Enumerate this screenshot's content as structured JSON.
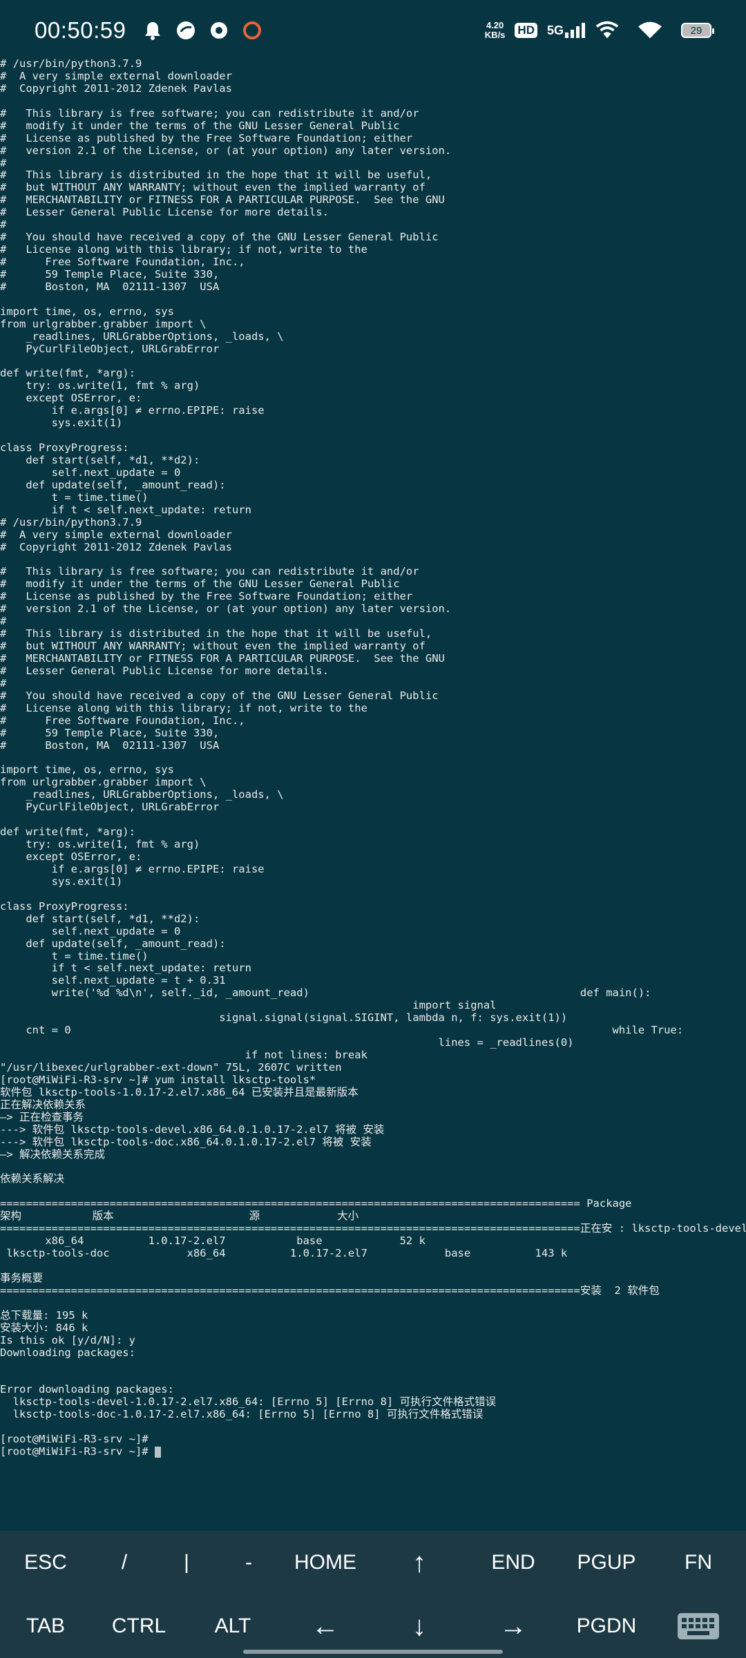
{
  "status_bar": {
    "time": "00:50:59",
    "net_speed_value": "4.20",
    "net_speed_unit": "KB/s",
    "hd_badge": "HD",
    "network": "5G",
    "battery": "29",
    "icons": [
      "bell-icon",
      "app-icon",
      "app-icon-2",
      "record-icon",
      "signal-icon",
      "wifi-calling-icon",
      "wifi-icon",
      "battery-icon"
    ]
  },
  "terminal": {
    "lines": [
      "# /usr/bin/python3.7.9",
      "#  A very simple external downloader",
      "#  Copyright 2011-2012 Zdenek Pavlas",
      "",
      "#   This library is free software; you can redistribute it and/or",
      "#   modify it under the terms of the GNU Lesser General Public",
      "#   License as published by the Free Software Foundation; either",
      "#   version 2.1 of the License, or (at your option) any later version.",
      "#",
      "#   This library is distributed in the hope that it will be useful,",
      "#   but WITHOUT ANY WARRANTY; without even the implied warranty of",
      "#   MERCHANTABILITY or FITNESS FOR A PARTICULAR PURPOSE.  See the GNU",
      "#   Lesser General Public License for more details.",
      "#",
      "#   You should have received a copy of the GNU Lesser General Public",
      "#   License along with this library; if not, write to the",
      "#      Free Software Foundation, Inc.,",
      "#      59 Temple Place, Suite 330,",
      "#      Boston, MA  02111-1307  USA",
      "",
      "import time, os, errno, sys",
      "from urlgrabber.grabber import \\",
      "    _readlines, URLGrabberOptions, _loads, \\",
      "    PyCurlFileObject, URLGrabError",
      "",
      "def write(fmt, *arg):",
      "    try: os.write(1, fmt % arg)",
      "    except OSError, e:",
      "        if e.args[0] ≠ errno.EPIPE: raise",
      "        sys.exit(1)",
      "",
      "class ProxyProgress:",
      "    def start(self, *d1, **d2):",
      "        self.next_update = 0",
      "    def update(self, _amount_read):",
      "        t = time.time()",
      "        if t < self.next_update: return",
      "# /usr/bin/python3.7.9",
      "#  A very simple external downloader",
      "#  Copyright 2011-2012 Zdenek Pavlas",
      "",
      "#   This library is free software; you can redistribute it and/or",
      "#   modify it under the terms of the GNU Lesser General Public",
      "#   License as published by the Free Software Foundation; either",
      "#   version 2.1 of the License, or (at your option) any later version.",
      "#",
      "#   This library is distributed in the hope that it will be useful,",
      "#   but WITHOUT ANY WARRANTY; without even the implied warranty of",
      "#   MERCHANTABILITY or FITNESS FOR A PARTICULAR PURPOSE.  See the GNU",
      "#   Lesser General Public License for more details.",
      "#",
      "#   You should have received a copy of the GNU Lesser General Public",
      "#   License along with this library; if not, write to the",
      "#      Free Software Foundation, Inc.,",
      "#      59 Temple Place, Suite 330,",
      "#      Boston, MA  02111-1307  USA",
      "",
      "import time, os, errno, sys",
      "from urlgrabber.grabber import \\",
      "    _readlines, URLGrabberOptions, _loads, \\",
      "    PyCurlFileObject, URLGrabError",
      "",
      "def write(fmt, *arg):",
      "    try: os.write(1, fmt % arg)",
      "    except OSError, e:",
      "        if e.args[0] ≠ errno.EPIPE: raise",
      "        sys.exit(1)",
      "",
      "class ProxyProgress:",
      "    def start(self, *d1, **d2):",
      "        self.next_update = 0",
      "    def update(self, _amount_read):",
      "        t = time.time()",
      "        if t < self.next_update: return",
      "        self.next_update = t + 0.31",
      "        write('%d %d\\n', self._id, _amount_read)                                          def main():",
      "                                                                import signal",
      "                                  signal.signal(signal.SIGINT, lambda n, f: sys.exit(1))",
      "    cnt = 0                                                                                    while True:",
      "                                                                    lines = _readlines(0)",
      "                                      if not lines: break",
      "\"/usr/libexec/urlgrabber-ext-down\" 75L, 2607C written",
      "[root@MiWiFi-R3-srv ~]# yum install lksctp-tools*",
      "软件包 lksctp-tools-1.0.17-2.el7.x86_64 已安装并且是最新版本",
      "正在解决依赖关系",
      "—> 正在检查事务",
      "---> 软件包 lksctp-tools-devel.x86_64.0.1.0.17-2.el7 将被 安装",
      "---> 软件包 lksctp-tools-doc.x86_64.0.1.0.17-2.el7 将被 安装",
      "—> 解决依赖关系完成",
      "",
      "依赖关系解决",
      "",
      "========================================================================================== Package",
      "架构           版本                     源            大小",
      "==========================================================================================正在安 : lksctp-tools-devel",
      "       x86_64          1.0.17-2.el7           base            52 k",
      " lksctp-tools-doc            x86_64          1.0.17-2.el7            base          143 k",
      "",
      "事务概要",
      "==========================================================================================安装  2 软件包",
      "",
      "总下载量: 195 k",
      "安装大小: 846 k",
      "Is this ok [y/d/N]: y",
      "Downloading packages:",
      "",
      "",
      "Error downloading packages:",
      "  lksctp-tools-devel-1.0.17-2.el7.x86_64: [Errno 5] [Errno 8] 可执行文件格式错误",
      "  lksctp-tools-doc-1.0.17-2.el7.x86_64: [Errno 5] [Errno 8] 可执行文件格式错误",
      "",
      "[root@MiWiFi-R3-srv ~]#",
      "[root@MiWiFi-R3-srv ~]# "
    ]
  },
  "extra_keys": {
    "row1": [
      "ESC",
      "/",
      "|",
      "-",
      "HOME",
      "↑",
      "END",
      "PGUP",
      "FN"
    ],
    "row2": [
      "TAB",
      "CTRL",
      "ALT",
      "←",
      "↓",
      "→",
      "PGDN"
    ],
    "keyboard_icon": "keyboard-icon"
  },
  "colors": {
    "background": "#073642",
    "extra_keys_background": "#1d3a44",
    "text": "#eaeaea"
  }
}
